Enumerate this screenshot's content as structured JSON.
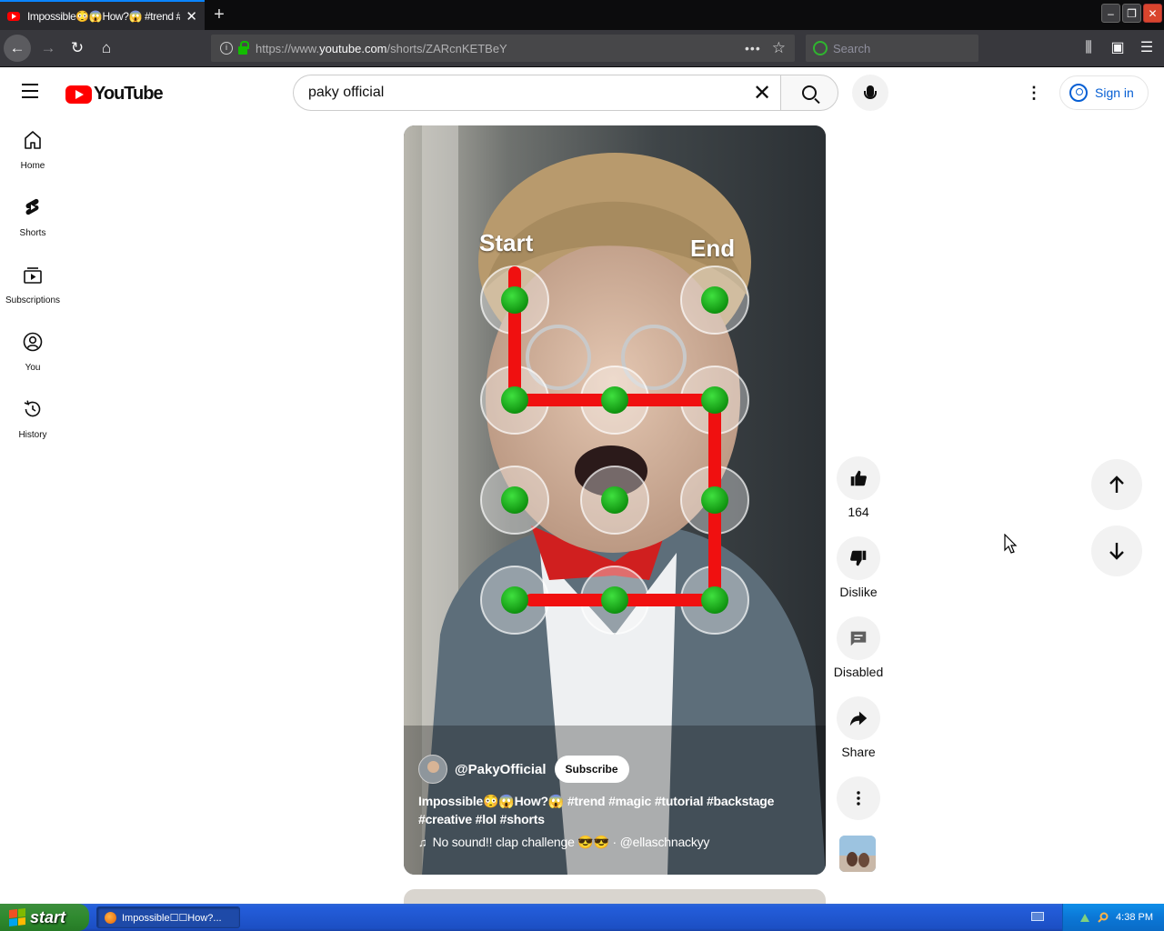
{
  "browser": {
    "tab_title": "Impossible😳😱How?😱 #trend #m",
    "url_prefix": "https://www.",
    "url_host": "youtube.com",
    "url_path": "/shorts/ZARcnKETBeY",
    "search_placeholder": "Search"
  },
  "masthead": {
    "logo_text": "YouTube",
    "search_query": "paky official",
    "signin_label": "Sign in"
  },
  "guide": {
    "items": [
      {
        "label": "Home",
        "icon": "home-icon"
      },
      {
        "label": "Shorts",
        "icon": "shorts-icon"
      },
      {
        "label": "Subscriptions",
        "icon": "subscriptions-icon"
      },
      {
        "label": "You",
        "icon": "you-icon"
      },
      {
        "label": "History",
        "icon": "history-icon"
      }
    ]
  },
  "short": {
    "overlay_start": "Start",
    "overlay_end": "End",
    "channel": "@PakyOfficial",
    "subscribe_label": "Subscribe",
    "title_line1": "Impossible😳😱How?😱 #trend #magic #tutorial #backstage",
    "title_line2": "#creative #lol #shorts",
    "music": "No sound!! clap challenge 😎😎 · @ellaschnackyy"
  },
  "actions": {
    "like_count": "164",
    "dislike_label": "Dislike",
    "comments_label": "Disabled",
    "share_label": "Share"
  },
  "taskbar": {
    "start_label": "start",
    "task_label": "Impossible☐☐How?...",
    "clock": "4:38 PM"
  },
  "colors": {
    "yt_red": "#ff0000",
    "link_blue": "#065fd4",
    "firefox_dark": "#38383d",
    "xp_blue": "#245edb"
  }
}
